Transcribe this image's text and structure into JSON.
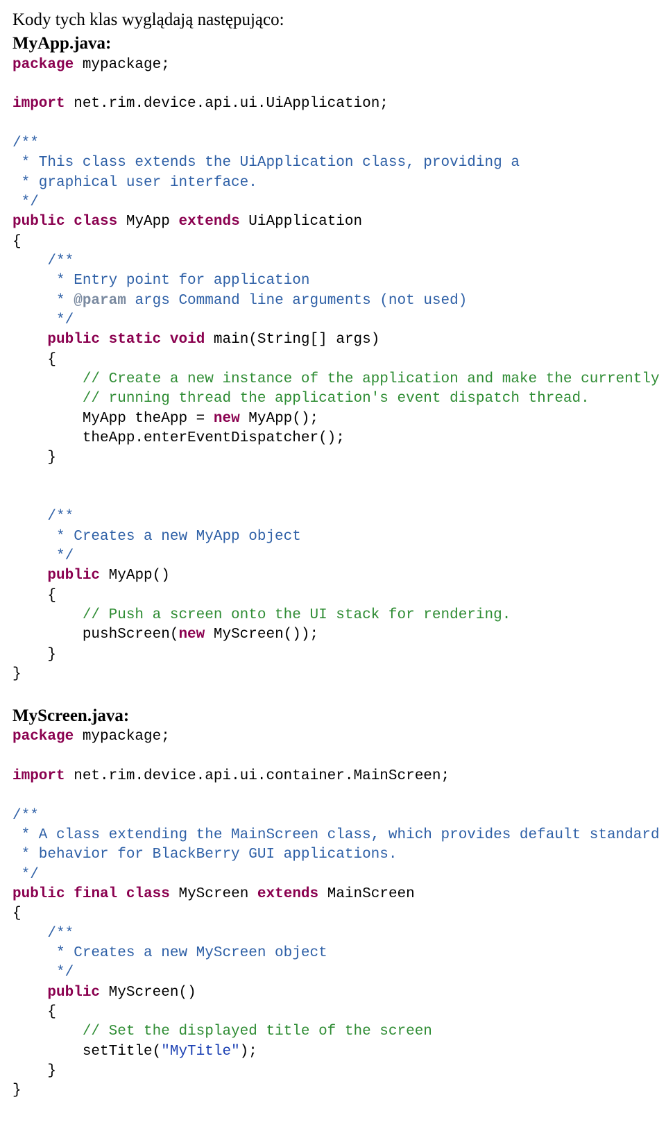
{
  "intro": "Kody tych klas wyglądają następująco:",
  "file1_heading": "MyApp.java:",
  "file2_heading": "MyScreen.java:",
  "code1": {
    "l1_kw": "package",
    "l1_rest": " mypackage;",
    "l2_kw": "import",
    "l2_rest": " net.rim.device.api.ui.UiApplication;",
    "jd1_a": "/**",
    "jd1_b": " * This class extends the UiApplication class, providing a",
    "jd1_c": " * graphical user interface.",
    "jd1_d": " */",
    "cls_kw1": "public",
    "cls_kw2": "class",
    "cls_name": " MyApp ",
    "cls_kw3": "extends",
    "cls_rest": " UiApplication",
    "brace_open": "{",
    "jd2_a": "    /**",
    "jd2_b": "     * Entry point for application",
    "jd2_c_pre": "     * ",
    "jd2_c_tag": "@param",
    "jd2_c_post": " args Command line arguments (not used)",
    "jd2_d": "     */",
    "main_pre": "    ",
    "main_kw1": "public",
    "main_kw2": "static",
    "main_kw3": "void",
    "main_rest": " main(String[] args)",
    "main_open": "    {",
    "cmt1": "        // Create a new instance of the application and make the currently",
    "cmt2": "        // running thread the application's event dispatch thread.",
    "new_pre": "        MyApp theApp = ",
    "new_kw": "new",
    "new_post": " MyApp();",
    "dispatch": "        theApp.enterEventDispatcher();",
    "main_close": "    }",
    "jd3_a": "    /**",
    "jd3_b": "     * Creates a new MyApp object",
    "jd3_c": "     */",
    "ctor_pre": "    ",
    "ctor_kw": "public",
    "ctor_rest": " MyApp()",
    "ctor_open": "    {",
    "cmt3": "        // Push a screen onto the UI stack for rendering.",
    "push_pre": "        pushScreen(",
    "push_kw": "new",
    "push_post": " MyScreen());",
    "ctor_close": "    }",
    "cls_close": "}"
  },
  "code2": {
    "l1_kw": "package",
    "l1_rest": " mypackage;",
    "l2_kw": "import",
    "l2_rest": " net.rim.device.api.ui.container.MainScreen;",
    "jd1_a": "/**",
    "jd1_b": " * A class extending the MainScreen class, which provides default standard",
    "jd1_c": " * behavior for BlackBerry GUI applications.",
    "jd1_d": " */",
    "cls_kw1": "public",
    "cls_kw2": "final",
    "cls_kw3": "class",
    "cls_name": " MyScreen ",
    "cls_kw4": "extends",
    "cls_rest": " MainScreen",
    "brace_open": "{",
    "jd2_a": "    /**",
    "jd2_b": "     * Creates a new MyScreen object",
    "jd2_c": "     */",
    "ctor_pre": "    ",
    "ctor_kw": "public",
    "ctor_rest": " MyScreen()",
    "ctor_open": "    {",
    "cmt1": "        // Set the displayed title of the screen",
    "title_pre": "        setTitle(",
    "title_str": "\"MyTitle\"",
    "title_post": ");",
    "ctor_close": "    }",
    "cls_close": "}"
  }
}
